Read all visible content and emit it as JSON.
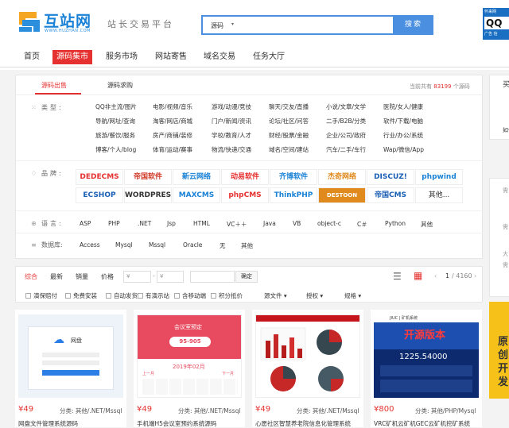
{
  "header": {
    "logo_text": "互站网",
    "logo_url": "WWW.HUZHAN.COM",
    "slogan": "站长交易平台",
    "search_category": "源码",
    "search_button": "搜索",
    "ad": {
      "line1": "怀来网",
      "line2": "QQ",
      "line3": "广告 信"
    }
  },
  "nav": [
    "首页",
    "源码集市",
    "服务市场",
    "网站寄售",
    "域名交易",
    "任务大厅"
  ],
  "tabs": {
    "sale": "源码出售",
    "buy": "源码求购"
  },
  "count": {
    "prefix": "当前共有",
    "num": "83199",
    "suffix": "个源码"
  },
  "type_label": "类型:",
  "types": [
    [
      "QQ非主流/图片",
      "电影/视频/音乐",
      "游戏/动漫/竞技",
      "聊天/交友/直播",
      "小说/文章/文学",
      "医院/女人/健康"
    ],
    [
      "导航/网址/查询",
      "淘客/网店/商城",
      "门户/新闻/资讯",
      "论坛/社区/问答",
      "二手/B2B/分类",
      "软件/下载/电脑"
    ],
    [
      "旅游/餐饮/服务",
      "房产/商铺/装修",
      "学校/教育/人才",
      "财经/股票/金融",
      "企业/公司/政府",
      "行业/办公/系统"
    ],
    [
      "博客/个人/blog",
      "体育/运动/赛事",
      "物流/快递/交通",
      "域名/空间/建站",
      "汽车/二手/车行",
      "Wap/微信/App"
    ]
  ],
  "brand_label": "品牌:",
  "brands": [
    [
      "DEDECMS",
      "帝国软件",
      "新云网络",
      "动易软件",
      "齐博软件",
      "杰奇网络",
      "DISCUZ!",
      "phpwind"
    ],
    [
      "ECSHOP",
      "WORDPRESS",
      "MAXCMS",
      "phpCMS",
      "ThinkPHP",
      "DESTOON",
      "帝国CMS",
      "其他..."
    ]
  ],
  "lang_label": "语言:",
  "languages": [
    "ASP",
    "PHP",
    ".NET",
    "Jsp",
    "HTML",
    "VC＋＋",
    "Java",
    "VB",
    "object-c",
    "C＃",
    "Python",
    "其他"
  ],
  "db_label": "数据库:",
  "databases": [
    "Access",
    "Mysql",
    "Mssql",
    "Oracle",
    "无",
    "其他"
  ],
  "sort": {
    "items": [
      "综合",
      "最新",
      "销量",
      "价格"
    ],
    "price_from": "¥",
    "price_to": "¥",
    "confirm": "确定",
    "page": "1",
    "total_pages": "/ 4160"
  },
  "options": [
    "演保赔付",
    "免费安装",
    "自动发货",
    "有演示站",
    "含移动端",
    "积分抵价",
    "源文件",
    "授权",
    "规格"
  ],
  "cards": [
    {
      "price": "¥49",
      "category": "分类: 其他/.NET/Mssql",
      "title": "网盘文件管理系统源码",
      "thumb_label": "网盘"
    },
    {
      "price": "¥49",
      "category": "分类: 其他/.NET/Mssql",
      "title": "手机端H5会议室预约系统源码",
      "thumb_label": "会议室预定",
      "thumb_sub": "95-905",
      "thumb_date": "2019年02月",
      "thumb_prev": "上一月",
      "thumb_next": "下一月"
    },
    {
      "price": "¥49",
      "category": "分类: 其他/.NET/Mssql",
      "title": "心愿社区智慧养老院信息化管理系统"
    },
    {
      "price": "¥800",
      "category": "分类: 其他/PHP/Mysql",
      "title": "VRC矿机云矿机GEC云矿机挖矿系统",
      "thumb_title": "JIUC | 矿机系统",
      "thumb_banner": "开源版本",
      "thumb_num": "1225.54000"
    }
  ],
  "side": {
    "top": "买",
    "t2": "如何",
    "s1": "需",
    "s2": "需",
    "s3": "大",
    "s4": "需",
    "banner": "原创开发"
  }
}
